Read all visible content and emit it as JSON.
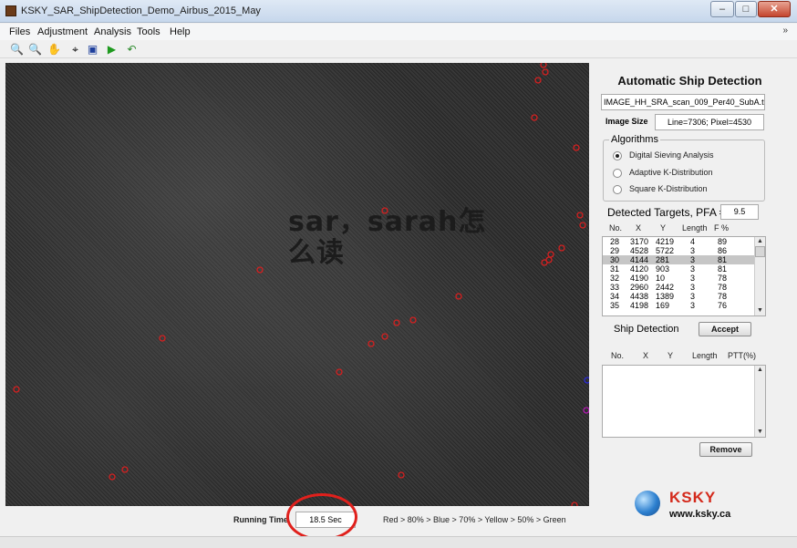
{
  "window": {
    "title": "KSKY_SAR_ShipDetection_Demo_Airbus_2015_May",
    "controls": [
      "–",
      "□",
      "✕"
    ]
  },
  "menu": {
    "items": [
      "Files",
      "Adjustment",
      "Analysis",
      "Tools",
      "Help"
    ],
    "overflow": "»"
  },
  "toolbar": {
    "icons": [
      {
        "name": "zoom-in-icon",
        "glyph": "🔍"
      },
      {
        "name": "zoom-out-icon",
        "glyph": "🔍"
      },
      {
        "name": "pan-hand-icon",
        "glyph": "✋"
      },
      {
        "name": "data-cursor-icon",
        "glyph": "⌖"
      },
      {
        "name": "select-box-icon",
        "glyph": "▣"
      },
      {
        "name": "run-icon",
        "glyph": "▶"
      },
      {
        "name": "undo-icon",
        "glyph": "↶"
      }
    ]
  },
  "overlay": {
    "line1": "sar，sarah怎",
    "line2": "么读"
  },
  "bottom": {
    "running_time_label": "Running Time",
    "running_time_value": "18.5 Sec",
    "legend": "Red > 80% > Blue > 70% > Yellow > 50% > Green"
  },
  "side": {
    "title": "Automatic Ship Detection",
    "file_name": "IMAGE_HH_SRA_scan_009_Per40_SubA.tif",
    "image_size_label": "Image Size",
    "image_size_value": "Line=7306;   Pixel=4530",
    "algorithms": {
      "legend": "Algorithms",
      "options": [
        "Digital Sieving Analysis",
        "Adaptive K-Distribution",
        "Square K-Distribution"
      ],
      "selected_index": 0
    },
    "pfa_label": "Detected Targets, PFA =",
    "pfa_value": "9.5",
    "targets_headers": [
      "No.",
      "X",
      "Y",
      "Length",
      "F %"
    ],
    "targets": [
      [
        "28",
        "3170",
        "4219",
        "4",
        "89"
      ],
      [
        "29",
        "4528",
        "5722",
        "3",
        "86"
      ],
      [
        "30",
        "4144",
        "281",
        "3",
        "81"
      ],
      [
        "31",
        "4120",
        "903",
        "3",
        "81"
      ],
      [
        "32",
        "4190",
        "10",
        "3",
        "78"
      ],
      [
        "33",
        "2960",
        "2442",
        "3",
        "78"
      ],
      [
        "34",
        "4438",
        "1389",
        "3",
        "78"
      ],
      [
        "35",
        "4198",
        "169",
        "3",
        "76"
      ]
    ],
    "selected_target_index": 2,
    "ship_detection_label": "Ship Detection",
    "accept_label": "Accept",
    "ships_headers": [
      "No.",
      "X",
      "Y",
      "Length",
      "PTT(%)"
    ],
    "remove_label": "Remove",
    "logo_text": "KSKY",
    "logo_url": "www.ksky.ca"
  },
  "colors": {
    "target_red": "#d42020",
    "target_blue": "#2a2ad8",
    "target_magenta": "#b01ab0",
    "highlight_circle": "#e0201c"
  }
}
